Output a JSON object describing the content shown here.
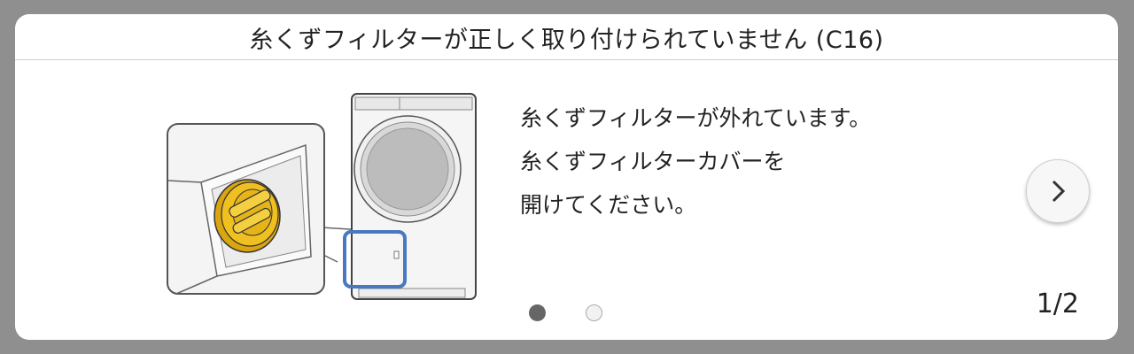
{
  "dialog": {
    "title": "糸くずフィルターが正しく取り付けられていません (C16)"
  },
  "message": {
    "lines": [
      "糸くずフィルターが外れています。",
      "糸くずフィルターカバーを",
      "開けてください。"
    ]
  },
  "pagination": {
    "current": 1,
    "total": 2,
    "label": "1/2"
  },
  "icons": {
    "next": "chevron-right-icon"
  },
  "colors": {
    "background": "#8f8f8f",
    "card": "#ffffff",
    "highlight": "#4a78c0",
    "filter_cap": "#f0c020",
    "dot_active": "#666666"
  }
}
